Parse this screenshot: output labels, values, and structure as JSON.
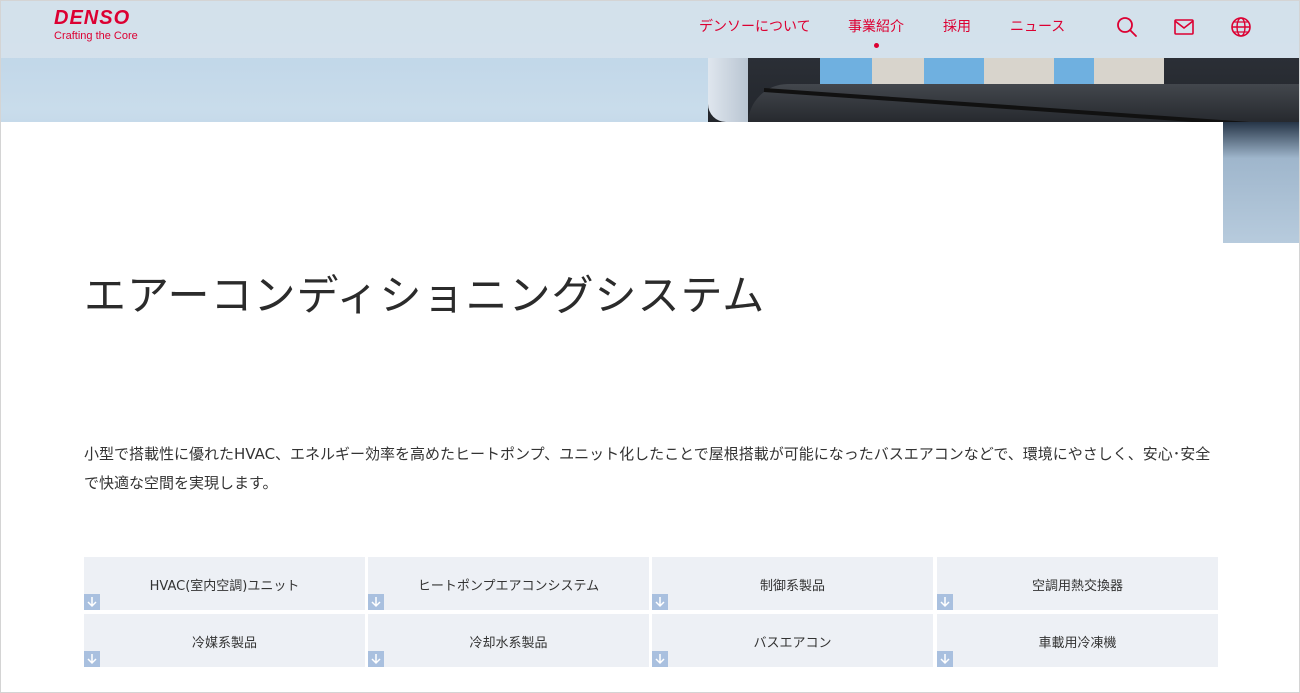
{
  "header": {
    "logo": {
      "wordmark": "DENSO",
      "tagline": "Crafting the Core"
    },
    "nav": [
      {
        "label": "デンソーについて",
        "active": false
      },
      {
        "label": "事業紹介",
        "active": true
      },
      {
        "label": "採用",
        "active": false
      },
      {
        "label": "ニュース",
        "active": false
      }
    ],
    "icons": [
      "search-icon",
      "mail-icon",
      "globe-icon"
    ]
  },
  "main": {
    "title": "エアーコンディショニングシステム",
    "description": "小型で搭載性に優れたHVAC、エネルギー効率を高めたヒートポンプ、ユニット化したことで屋根搭載が可能になったバスエアコンなどで、環境にやさしく、安心･安全で快適な空間を実現します。",
    "tiles": [
      {
        "label": "HVAC(室内空調)ユニット"
      },
      {
        "label": "ヒートポンプエアコンシステム"
      },
      {
        "label": "制御系製品"
      },
      {
        "label": "空調用熱交換器"
      },
      {
        "label": "冷媒系製品"
      },
      {
        "label": "冷却水系製品"
      },
      {
        "label": "バスエアコン"
      },
      {
        "label": "車載用冷凍機"
      }
    ]
  },
  "colors": {
    "brand": "#dc0032",
    "tile_bg": "#edf0f5",
    "tile_arrow": "#a9c0df"
  }
}
